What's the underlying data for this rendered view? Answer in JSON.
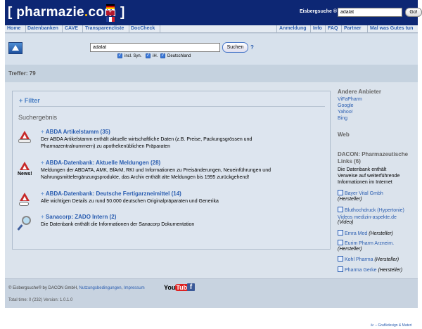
{
  "header": {
    "logo_prefix": "[ ",
    "logo_name": "pharmazie",
    "logo_dot": ".",
    "logo_tld": "com",
    "logo_suffix": " ]",
    "search_label": "Eisbergsuche ®",
    "search_value": "adalat",
    "go_label": "Go!"
  },
  "nav": {
    "left": [
      "Home",
      "Datenbanken",
      "CAVE",
      "Transparenzliste",
      "DocCheck"
    ],
    "right": [
      "Anmeldung",
      "Info",
      "FAQ",
      "Partner",
      "Mal was Gutes tun"
    ]
  },
  "search": {
    "value": "adalat",
    "button": "Suchen",
    "help": "?",
    "options": [
      "incl. Syn.",
      "iH.",
      "Deutschland"
    ]
  },
  "hits_label": "Treffer: 79",
  "filter_label": "+ Filter",
  "results_title": "Suchergebnis",
  "results": [
    {
      "title": "ABDA Artikelstamm (35)",
      "desc": "Der ABDA Artikelstamm enthält aktuelle wirtschaftliche Daten (z.B. Preise, Packungsgrössen und Pharmazentralnummern) zu apothekenüblichen Präparaten",
      "icon": "warning-icon"
    },
    {
      "title": "ABDA-Datenbank: Aktuelle Meldungen (28)",
      "desc": "Meldungen der ABDATA, AMK, BfArM, RKI und Informationen zu Preisänderungen, Neueinführungen und Nahrungsmittelergänzungsprodukte, das Archiv enthält alte Meldungen bis 1995 zurückgehend!",
      "icon": "news-icon",
      "badge": "News!"
    },
    {
      "title": "ABDA-Datenbank: Deutsche Fertigarzneimittel (14)",
      "desc": "Alle wichtigen Details zu rund 50.000 deutschen Originalpräparaten und Generika",
      "icon": "pill-icon"
    },
    {
      "title": "Sanacorp: ZADO Intern (2)",
      "desc": "Die Datenbank enthält die Informationen der Sanacorp Dokumentation",
      "icon": "magnifier-icon"
    }
  ],
  "sidebar": {
    "other_heading": "Andere Anbieter",
    "other_links": [
      "ViFaPharm",
      "Google",
      "Yahoo!",
      "Bing"
    ],
    "web_heading": "Web",
    "dacon_heading_1": "DACON: Pharmazeutische",
    "dacon_heading_2": "Links (6)",
    "dacon_text_1": "Die Datenbank enthält",
    "dacon_text_2": "Verweise auf weiterführende",
    "dacon_text_3": "Informationen im Internet",
    "links": [
      {
        "name": "Bayer Vital Gmbh",
        "type": "(Hersteller)"
      },
      {
        "name": "Bluthochdruck (Hypertonie) Videos medizin-aspekte.de",
        "type": "(Video)"
      },
      {
        "name": "Emra Med",
        "type": "(Hersteller)"
      },
      {
        "name": "Eurim Pharm Arzneim.",
        "type": "(Hersteller)"
      },
      {
        "name": "Kohl Pharma",
        "type": "(Hersteller)"
      },
      {
        "name": "Pharma Gerke",
        "type": "(Hersteller)"
      }
    ]
  },
  "footer": {
    "copy": "© Eisbergsuche® by DACON GmbH,",
    "link1": "Nutzungsbedingungen",
    "link2": "Impressum",
    "youtube_you": "You",
    "youtube_tube": "Tube",
    "facebook": "f",
    "time": "Total time: 0 (232) Version: 1.0.1.0"
  },
  "credit": "ä⁴ – Grafikdesign & Materi"
}
